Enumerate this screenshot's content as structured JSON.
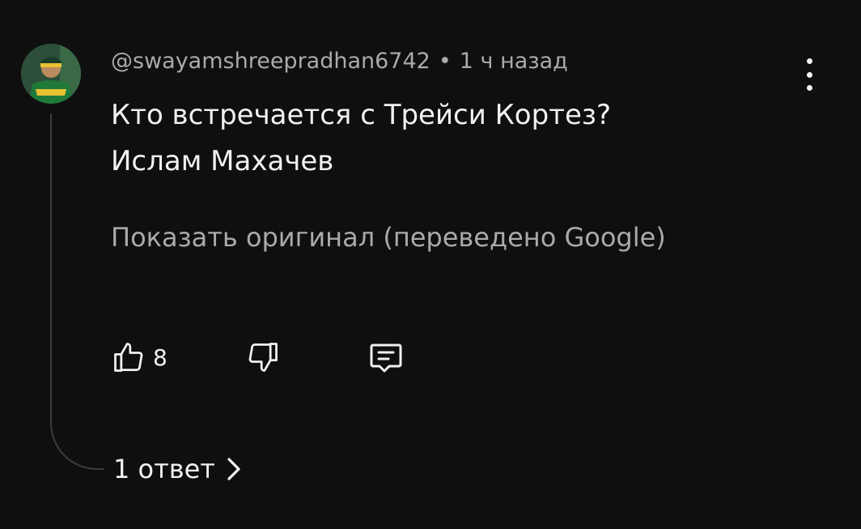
{
  "comment": {
    "author": "@swayamshreepradhan6742",
    "separator": "•",
    "time": "1 ч назад",
    "lines": [
      "Кто встречается с Трейси Кортез?",
      "Ислам Махачев"
    ],
    "show_original": "Показать оригинал (переведено Google)",
    "like_count": "8",
    "replies_label": "1 ответ"
  },
  "icons": {
    "more": "more-vert-icon",
    "like": "thumbs-up-icon",
    "dislike": "thumbs-down-icon",
    "reply": "comment-icon",
    "replies_chevron": "chevron-right-icon"
  },
  "colors": {
    "background": "#0f0f0f",
    "primary_text": "#f1f1f1",
    "secondary_text": "#aaaaaa",
    "thread_line": "#3d3d3d"
  }
}
